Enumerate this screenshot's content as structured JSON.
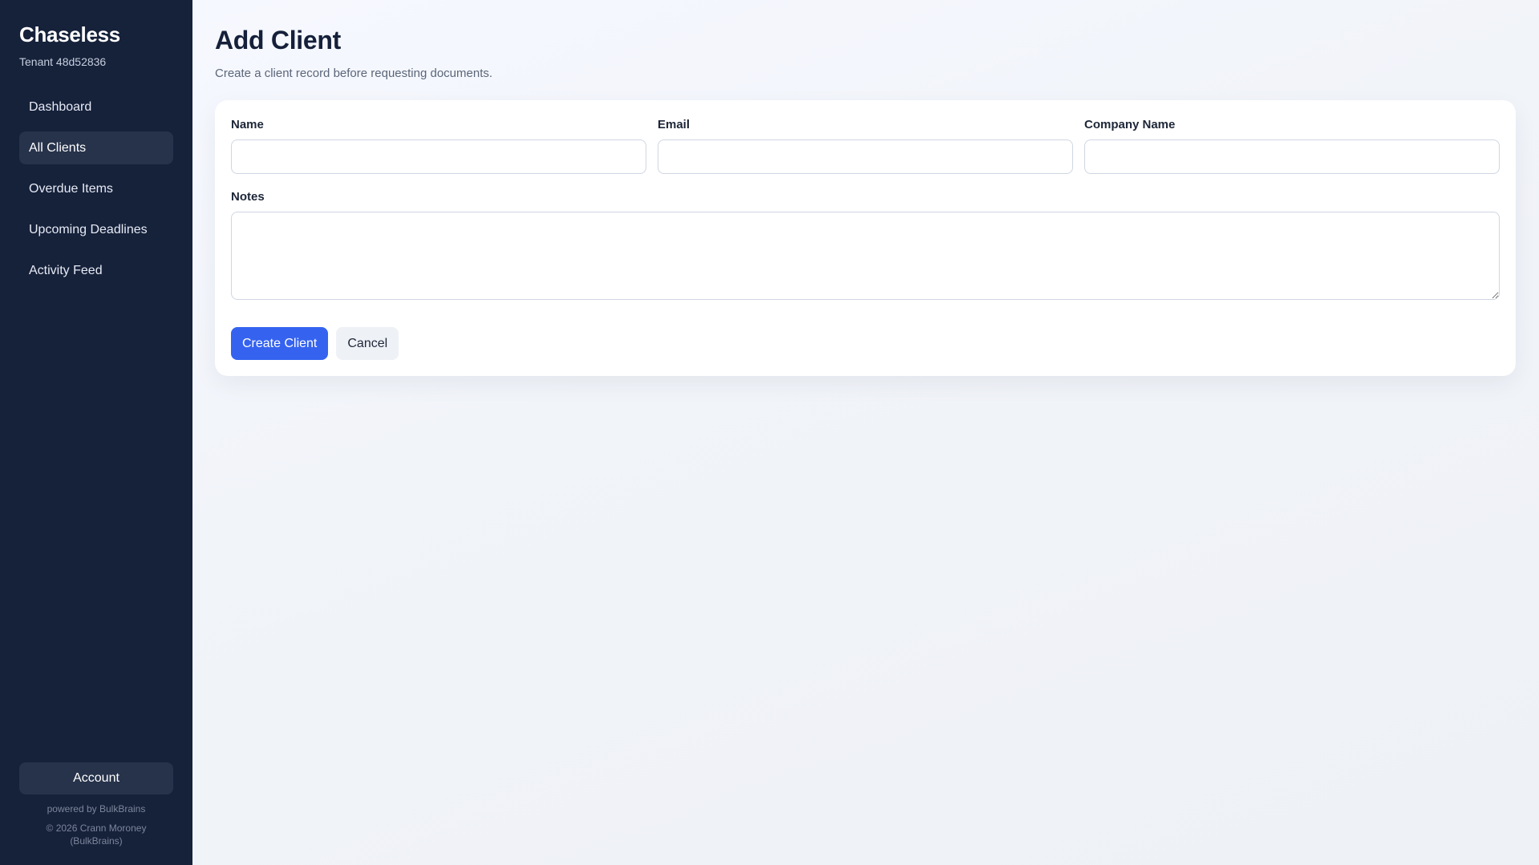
{
  "sidebar": {
    "brand": "Chaseless",
    "tenant": "Tenant 48d52836",
    "items": [
      {
        "label": "Dashboard",
        "active": false
      },
      {
        "label": "All Clients",
        "active": true
      },
      {
        "label": "Overdue Items",
        "active": false
      },
      {
        "label": "Upcoming Deadlines",
        "active": false
      },
      {
        "label": "Activity Feed",
        "active": false
      }
    ],
    "account_label": "Account",
    "powered_by": "powered by BulkBrains",
    "copyright_line1": "© 2026 Crann Moroney",
    "copyright_line2": "(BulkBrains)"
  },
  "main": {
    "title": "Add Client",
    "subtitle": "Create a client record before requesting documents.",
    "form": {
      "name_label": "Name",
      "name_value": "",
      "email_label": "Email",
      "email_value": "",
      "company_label": "Company Name",
      "company_value": "",
      "notes_label": "Notes",
      "notes_value": ""
    },
    "actions": {
      "create_label": "Create Client",
      "cancel_label": "Cancel"
    }
  },
  "colors": {
    "sidebar_bg": "#16213a",
    "nav_active_bg": "#27334b",
    "primary": "#3563f0"
  }
}
